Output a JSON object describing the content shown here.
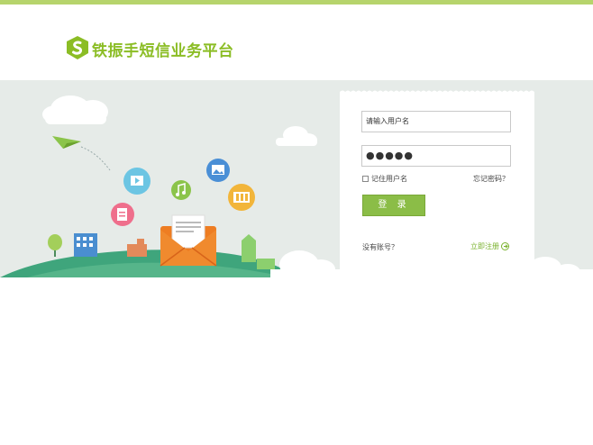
{
  "header": {
    "brand_name": "铁振手短信业务平台",
    "logo_icon": "shield-s-logo-icon"
  },
  "colors": {
    "accent_green": "#8bbd25",
    "top_bar": "#b6d46c",
    "banner_bg": "#e6ebe8",
    "login_button": "#8bbd47",
    "envelope": "#ee7d22"
  },
  "login": {
    "username_value": "请输入用户名",
    "password_value": "●●●●●",
    "remember_label": "记住用户名",
    "forgot_label": "忘记密码？",
    "login_button_label": "登 录",
    "no_account_label": "没有账号？",
    "register_label": "立即注册"
  },
  "illustration": {
    "icons": [
      "paper-plane-icon",
      "video-icon",
      "music-icon",
      "photo-icon",
      "document-icon",
      "folder-icon",
      "envelope-icon",
      "tree-icon",
      "building-icon",
      "cloud-icon"
    ]
  }
}
